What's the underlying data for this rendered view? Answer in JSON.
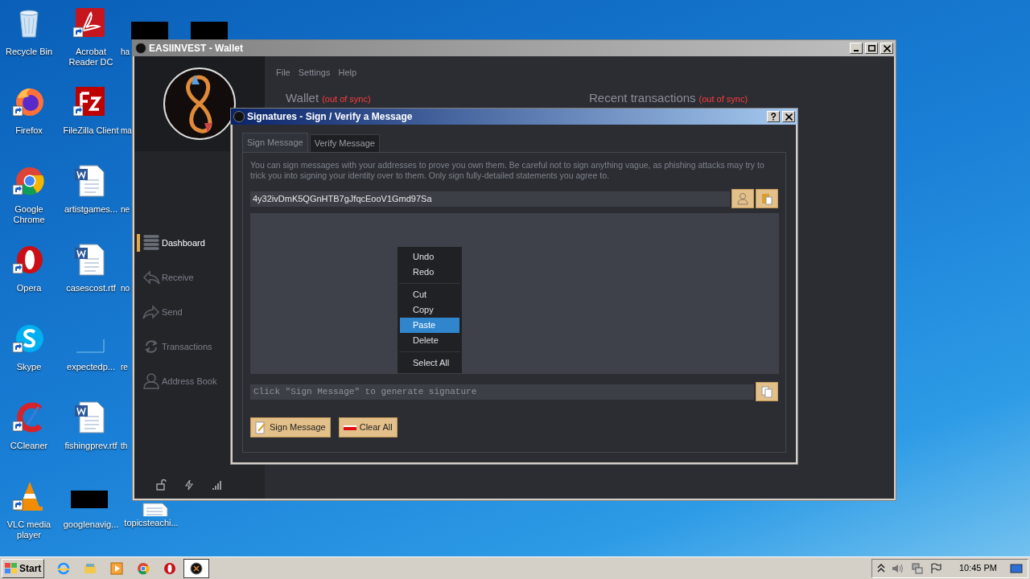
{
  "desktop_columns": [
    [
      {
        "kind": "recycle",
        "label": "Recycle Bin",
        "shortcut": false
      },
      {
        "kind": "firefox",
        "label": "Firefox",
        "shortcut": true
      },
      {
        "kind": "chrome",
        "label": "Google Chrome",
        "shortcut": true
      },
      {
        "kind": "opera",
        "label": "Opera",
        "shortcut": true
      },
      {
        "kind": "skype",
        "label": "Skype",
        "shortcut": true
      },
      {
        "kind": "ccleaner",
        "label": "CCleaner",
        "shortcut": true
      },
      {
        "kind": "vlc",
        "label": "VLC media player",
        "shortcut": true
      }
    ],
    [
      {
        "kind": "acrobat",
        "label": "Acrobat Reader DC",
        "shortcut": true
      },
      {
        "kind": "filezilla",
        "label": "FileZilla Client",
        "shortcut": true
      },
      {
        "kind": "word",
        "label": "artistgames..."
      },
      {
        "kind": "word",
        "label": "casescost.rtf"
      },
      {
        "kind": "blank",
        "label": "expectedp..."
      },
      {
        "kind": "word",
        "label": "fishingprev.rtf"
      },
      {
        "kind": "blacked",
        "label": "googlenavig..."
      }
    ],
    [
      {
        "kind": "blacked",
        "label": "ha"
      },
      {
        "kind": "none",
        "label": "ma"
      },
      {
        "kind": "none",
        "label": "ne"
      },
      {
        "kind": "none",
        "label": "no"
      },
      {
        "kind": "none",
        "label": "re"
      },
      {
        "kind": "none",
        "label": "th"
      },
      {
        "kind": "doc",
        "label": "topicsteachi..."
      }
    ],
    [
      {
        "kind": "blacked"
      }
    ]
  ],
  "wallet_window": {
    "title": "EASIINVEST - Wallet",
    "menu": [
      "File",
      "Settings",
      "Help"
    ],
    "sidebar": {
      "items": [
        {
          "kind": "dashboard",
          "label": "Dashboard",
          "selected": true
        },
        {
          "kind": "receive",
          "label": "Receive",
          "selected": false
        },
        {
          "kind": "send",
          "label": "Send",
          "selected": false
        },
        {
          "kind": "transactions",
          "label": "Transactions",
          "selected": false
        },
        {
          "kind": "address_book",
          "label": "Address Book",
          "selected": false
        }
      ]
    },
    "sections": [
      {
        "title": "Wallet",
        "status": "(out of sync)"
      },
      {
        "title": "Recent transactions",
        "status": "(out of sync)"
      }
    ]
  },
  "dialog": {
    "title": "Signatures - Sign / Verify a Message",
    "tabs": [
      {
        "label": "Sign Message",
        "selected": true
      },
      {
        "label": "Verify Message",
        "selected": false
      }
    ],
    "description": "You can sign messages with your addresses to prove you own them. Be careful not to sign anything vague, as phishing attacks may try to trick you into signing your identity over to them. Only sign fully-detailed statements you agree to.",
    "address": {
      "value": "4y32ivDmK5QGnHTB7gJfqcEooV1Gmd97Sa"
    },
    "signature": {
      "placeholder": "Click \"Sign Message\" to generate signature"
    },
    "buttons": [
      {
        "kind": "sign",
        "label": "Sign Message"
      },
      {
        "kind": "clear",
        "label": "Clear All"
      }
    ],
    "context_menu": {
      "groups": [
        [
          {
            "label": "Undo",
            "selected": false
          },
          {
            "label": "Redo",
            "selected": false
          }
        ],
        [
          {
            "label": "Cut",
            "selected": false
          },
          {
            "label": "Copy",
            "selected": false
          },
          {
            "label": "Paste",
            "selected": true
          },
          {
            "label": "Delete",
            "selected": false
          }
        ],
        [
          {
            "label": "Select All",
            "selected": false
          }
        ]
      ]
    }
  },
  "taskbar": {
    "start": "Start",
    "apps": [
      {
        "kind": "ie",
        "active": false
      },
      {
        "kind": "explorer",
        "active": false
      },
      {
        "kind": "media",
        "active": false
      },
      {
        "kind": "chrome",
        "active": false
      },
      {
        "kind": "opera",
        "active": false
      },
      {
        "kind": "wallet",
        "active": true
      }
    ],
    "clock": "10:45 PM"
  }
}
